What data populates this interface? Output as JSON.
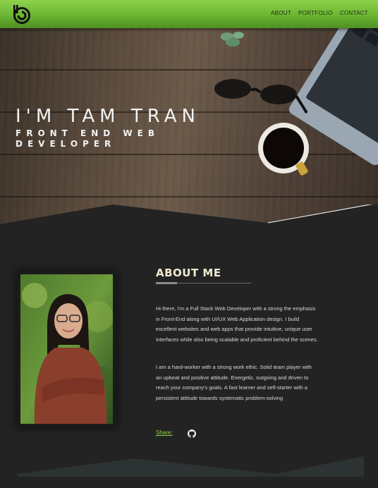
{
  "nav": {
    "logo_icon": "power-logo-icon",
    "links": [
      "ABOUT",
      "PORTFOLIO",
      "CONTACT"
    ]
  },
  "hero": {
    "title": "I'M TAM TRAN",
    "subtitle": "FRONT END WEB DEVELOPER"
  },
  "about": {
    "heading": "ABOUT ME",
    "paragraphs": [
      "Hi there, I'm a Full Stack Web Developer with a strong the emphasis in Front-End along with UI/UX Web Application design. I build excellent websites and web apps that provide intuitive, unique user interfaces while also being scalable and proficient behind the scenes.",
      "I am a hard-worker with a strong work ethic. Solid team player with an upbeat and positive attitude. Energetic, outgoing and driven to reach your company's goals. A fast learner and self-starter with a persistent attitude towards systematic problem-solving"
    ],
    "share_label": "Share:",
    "share_icon": "github-icon"
  },
  "colors": {
    "accent": "#8fd14a",
    "heading": "#f1ecd0",
    "background": "#232323"
  }
}
